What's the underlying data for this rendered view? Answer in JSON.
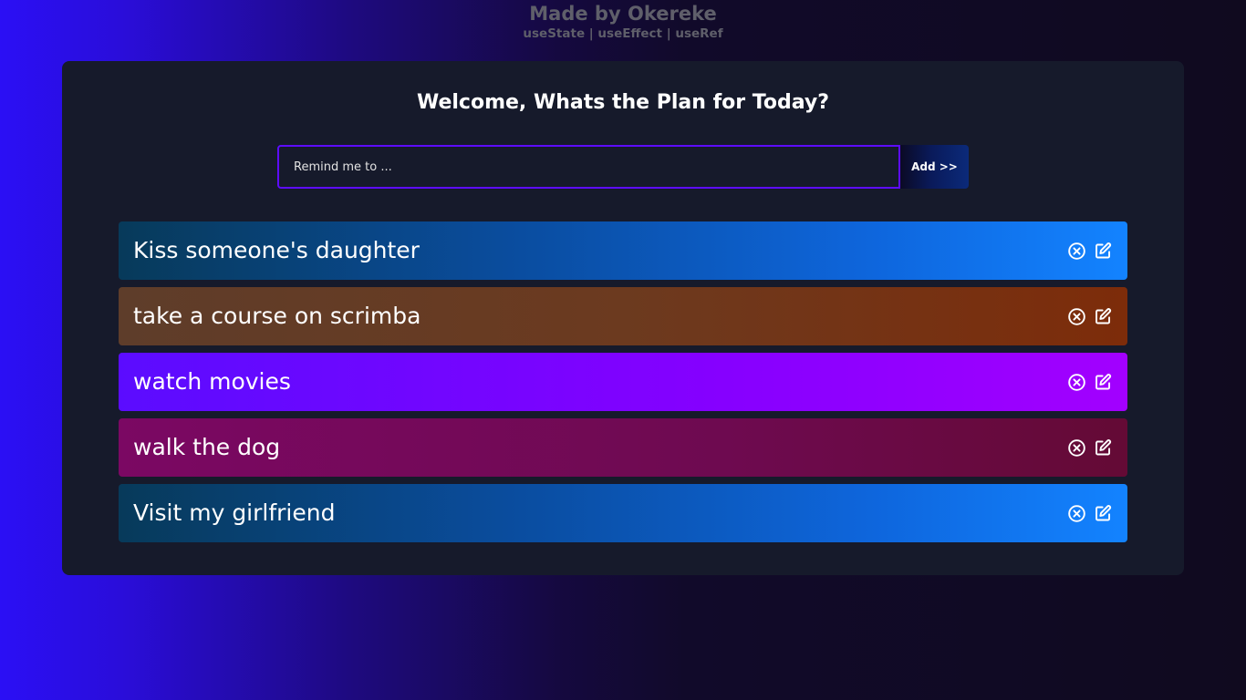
{
  "credit": {
    "title": "Made by Okereke",
    "hooks": "useState | useEffect | useRef"
  },
  "heading": "Welcome, Whats the Plan for Today?",
  "form": {
    "placeholder": "Remind me to ...",
    "value": "",
    "add_label": "Add >>"
  },
  "todos": [
    {
      "text": "Kiss someone's daughter",
      "color": "blue"
    },
    {
      "text": "take a course on scrimba",
      "color": "brown"
    },
    {
      "text": "watch movies",
      "color": "purple"
    },
    {
      "text": "walk the dog",
      "color": "maroon"
    },
    {
      "text": "Visit my girlfriend",
      "color": "blue"
    }
  ],
  "icons": {
    "delete": "close-circle-icon",
    "edit": "edit-icon"
  },
  "colors": {
    "accent": "#5d0cff",
    "panel": "#161a2b",
    "credit_text": "#5f5f6a"
  }
}
